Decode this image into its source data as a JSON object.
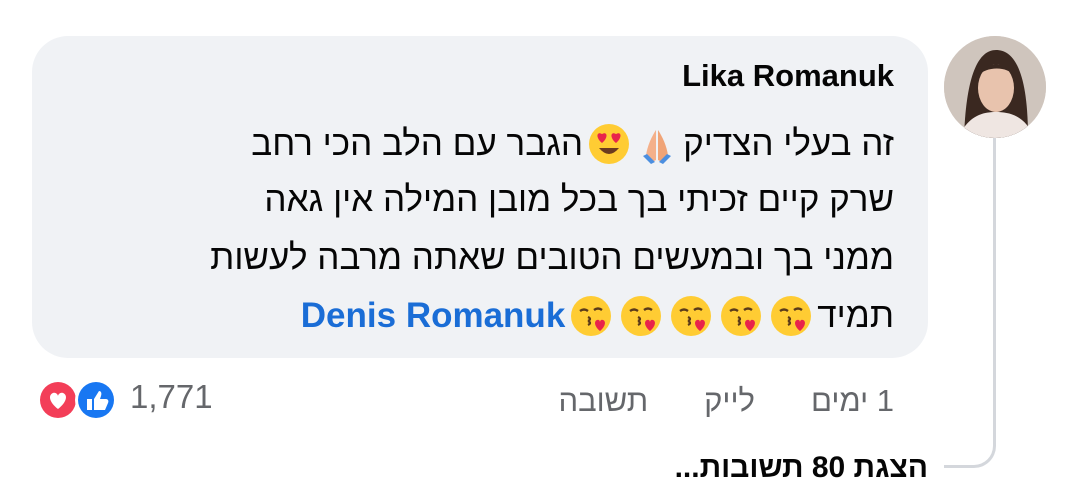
{
  "comment": {
    "author": "Lika Romanuk",
    "lines": [
      "זה בעלי הצדיק",
      "הגבר עם הלב הכי רחב",
      "שרק קיים זכיתי בך בכל מובן המילה אין גאה",
      "ממני בך ובמעשים הטובים שאתה מרבה לעשות",
      "תמיד"
    ],
    "mention": "Denis Romanuk",
    "emojis": [
      "folded-hands",
      "heart-eyes",
      "kissing-heart"
    ]
  },
  "actions": {
    "time": "1 ימים",
    "like": "לייק",
    "reply": "תשובה"
  },
  "reactions": {
    "count": "1,771",
    "types": [
      "love",
      "like"
    ]
  },
  "replies": {
    "view_label": "הצגת 80 תשובות..."
  },
  "colors": {
    "bubble": "#f0f2f5",
    "mention": "#1a6dd6",
    "secondary_text": "#65676b",
    "like": "#1877f2",
    "love": "#f33e58"
  }
}
